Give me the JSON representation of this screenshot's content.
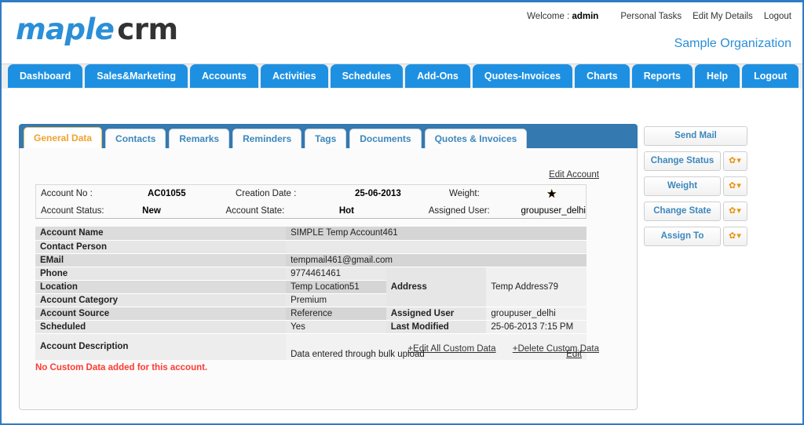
{
  "header": {
    "logo_maple": "maple",
    "logo_crm": "crm",
    "welcome_prefix": "Welcome :",
    "welcome_user": "admin",
    "links": [
      "Personal Tasks",
      "Edit My Details",
      "Logout"
    ],
    "organization": "Sample Organization",
    "accent_blue": "#2a8fd8"
  },
  "nav": {
    "items": [
      "Dashboard",
      "Sales&Marketing",
      "Accounts",
      "Activities",
      "Schedules",
      "Add-Ons",
      "Quotes-Invoices",
      "Charts",
      "Reports",
      "Help",
      "Logout"
    ],
    "tab_color": "#1e90e2"
  },
  "detail_tabs": {
    "items": [
      "General Data",
      "Contacts",
      "Remarks",
      "Reminders",
      "Tags",
      "Documents",
      "Quotes & Invoices"
    ],
    "active": "General Data",
    "active_color": "#f0a22e",
    "strip_color": "#3479b0"
  },
  "account": {
    "edit_account_link": "Edit Account",
    "summary": {
      "account_no_label": "Account No :",
      "account_no_value": "AC01055",
      "creation_date_label": "Creation Date :",
      "creation_date_value": "25-06-2013",
      "weight_label": "Weight:",
      "weight_value": "★",
      "account_status_label": "Account Status:",
      "account_status_value": "New",
      "account_state_label": "Account State:",
      "account_state_value": "Hot",
      "assigned_user_label": "Assigned User:",
      "assigned_user_value": "groupuser_delhi"
    },
    "rows": [
      {
        "label": "Account Name",
        "value": "SIMPLE Temp Account461",
        "label2": "",
        "value2": ""
      },
      {
        "label": "Contact Person",
        "value": "",
        "label2": "",
        "value2": ""
      },
      {
        "label": "EMail",
        "value": "tempmail461@gmail.com",
        "label2": "",
        "value2": ""
      },
      {
        "label": "Phone",
        "value": "9774461461",
        "label2": "Address",
        "value2": "Temp Address79"
      },
      {
        "label": "Location",
        "value": "Temp Location51",
        "label2": "",
        "value2": ""
      },
      {
        "label": "Account Category",
        "value": "Premium",
        "label2": "",
        "value2": ""
      },
      {
        "label": "Account Source",
        "value": "Reference",
        "label2": "Assigned User",
        "value2": "groupuser_delhi"
      },
      {
        "label": "Scheduled",
        "value": "Yes",
        "label2": "Last Modified",
        "value2": "25-06-2013 7:15 PM"
      }
    ],
    "description": {
      "label": "Account Description",
      "text": "Data entered through bulk upload",
      "edit_link": "Edit"
    },
    "custom_links": [
      "+Edit All Custom Data",
      "+Delete Custom Data"
    ],
    "no_custom_data": "No Custom Data added for this account.",
    "no_custom_data_color": "#ff3b30"
  },
  "actions": {
    "items": [
      {
        "label": "Send Mail",
        "has_dropdown": false
      },
      {
        "label": "Change Status",
        "has_dropdown": true
      },
      {
        "label": "Weight",
        "has_dropdown": true
      },
      {
        "label": "Change State",
        "has_dropdown": true
      },
      {
        "label": "Assign To",
        "has_dropdown": true
      }
    ],
    "dropdown_glyph": "✿▾",
    "label_color": "#3c87bd",
    "gear_color": "#e8920f"
  }
}
